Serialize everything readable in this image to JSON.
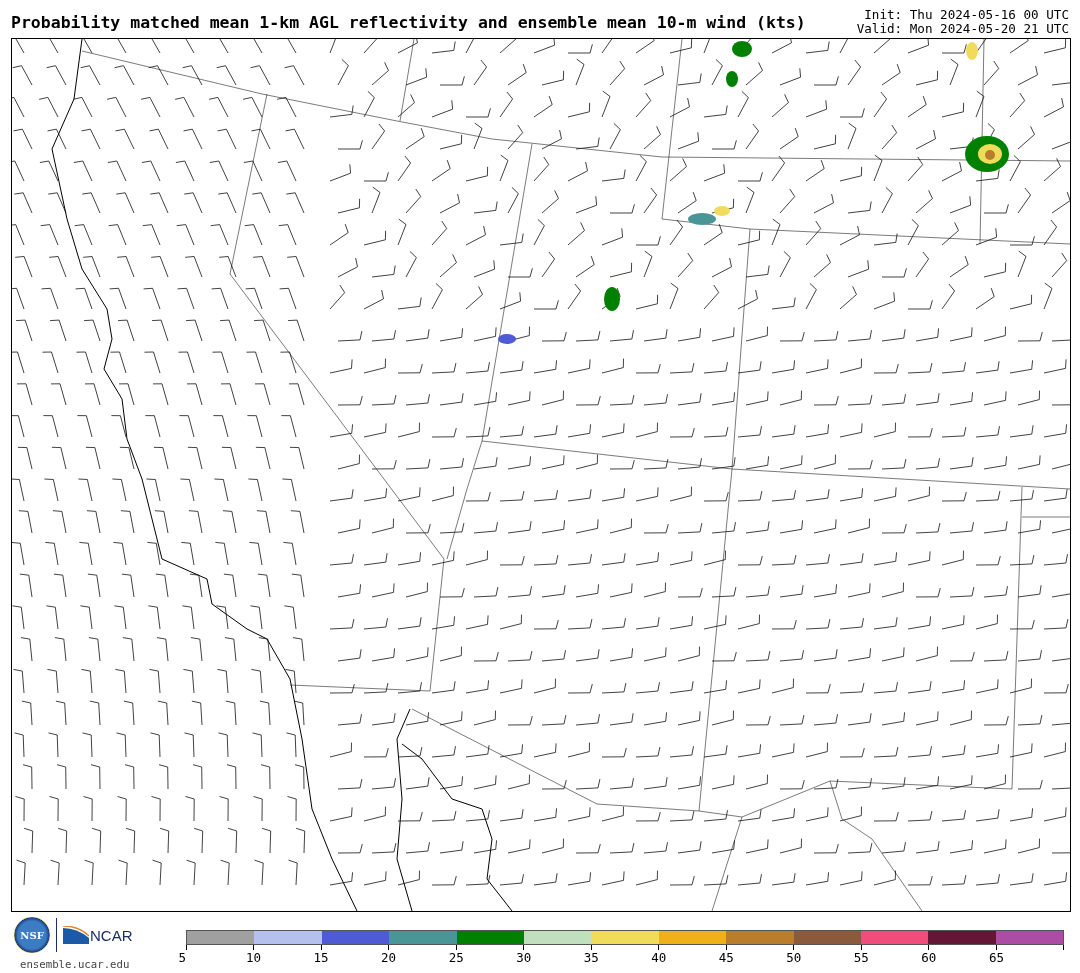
{
  "header": {
    "title": "Probability matched mean 1-km AGL reflectivity and ensemble mean 10-m wind (kts)",
    "init": "Init: Thu 2024-05-16 00 UTC",
    "valid": "Valid: Mon 2024-05-20 21 UTC"
  },
  "footer": {
    "logos": [
      {
        "kind": "nsf",
        "text": "NSF"
      },
      {
        "kind": "ncar",
        "text": "NCAR"
      }
    ],
    "url": "ensemble.ucar.edu"
  },
  "colorbar": {
    "segments": [
      {
        "color": "#a0a0a0"
      },
      {
        "color": "#b4c0ee"
      },
      {
        "color": "#4f5bd5"
      },
      {
        "color": "#4a9696"
      },
      {
        "color": "#008000"
      },
      {
        "color": "#bfdfbf"
      },
      {
        "color": "#f0dc5a"
      },
      {
        "color": "#f0b01a"
      },
      {
        "color": "#b97d2c"
      },
      {
        "color": "#8b5a3c"
      },
      {
        "color": "#f04c7c"
      },
      {
        "color": "#641634"
      },
      {
        "color": "#ac4ca4"
      }
    ],
    "ticks": [
      "5",
      "10",
      "15",
      "20",
      "25",
      "30",
      "35",
      "40",
      "45",
      "50",
      "55",
      "60",
      "65"
    ]
  }
}
